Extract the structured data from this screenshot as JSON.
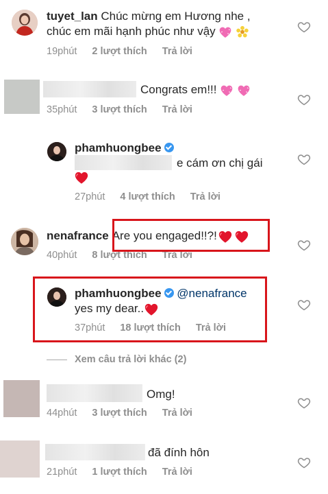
{
  "comments": [
    {
      "username": "tuyet_lan",
      "text_line1": "Chúc mừng em Hương nhe ,",
      "text_line2": "chúc em mãi hạnh phúc như vậy",
      "time": "19phút",
      "likes": "2 lượt thích",
      "reply": "Trả lời"
    },
    {
      "text": "Congrats em!!!",
      "time": "35phút",
      "likes": "3 lượt thích",
      "reply": "Trả lời"
    },
    {
      "username": "phamhuongbee",
      "text": "e cám ơn chị gái",
      "time": "27phút",
      "likes": "4 lượt thích",
      "reply": "Trả lời"
    },
    {
      "username": "nenafrance",
      "text": "Are you engaged!!?!",
      "time": "40phút",
      "likes": "8 lượt thích",
      "reply": "Trả lời"
    },
    {
      "username": "phamhuongbee",
      "mention": "@nenafrance",
      "text": "yes my dear..",
      "time": "37phút",
      "likes": "18 lượt thích",
      "reply": "Trả lời"
    },
    {
      "text": "Omg!",
      "time": "44phút",
      "likes": "3 lượt thích",
      "reply": "Trả lời"
    },
    {
      "text": "đã đính hôn",
      "time": "21phút",
      "likes": "1 lượt thích",
      "reply": "Trả lời"
    }
  ],
  "more_replies": "Xem câu trả lời khác (2)",
  "colors": {
    "highlight": "#d8151b",
    "heart": "#e2152c",
    "verified": "#3897f0"
  }
}
